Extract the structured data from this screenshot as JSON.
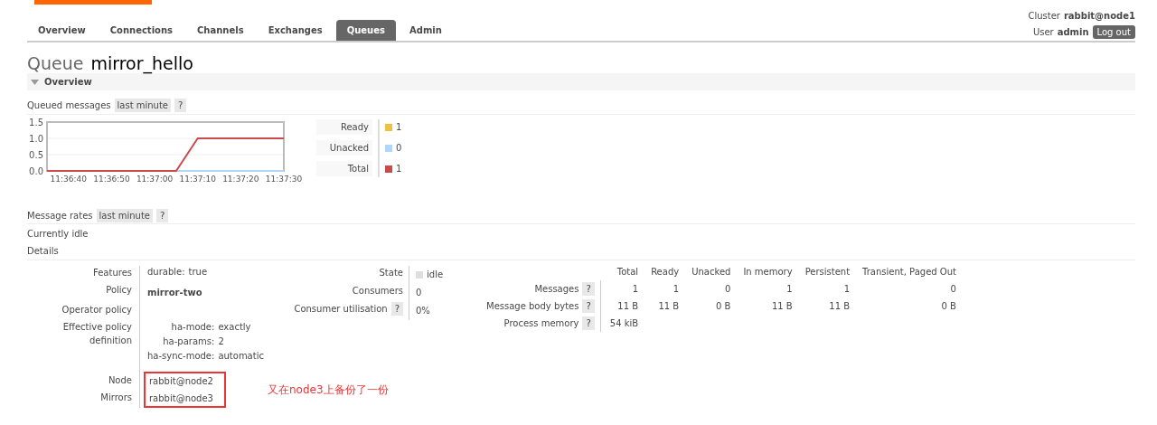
{
  "nav": {
    "tabs": [
      {
        "label": "Overview",
        "selected": false
      },
      {
        "label": "Connections",
        "selected": false
      },
      {
        "label": "Channels",
        "selected": false
      },
      {
        "label": "Exchanges",
        "selected": false
      },
      {
        "label": "Queues",
        "selected": true
      },
      {
        "label": "Admin",
        "selected": false
      }
    ]
  },
  "session": {
    "cluster_label": "Cluster",
    "cluster": "rabbit@node1",
    "user_label": "User",
    "user": "admin",
    "logout": "Log out"
  },
  "title": {
    "prefix": "Queue",
    "name": "mirror_hello"
  },
  "section": {
    "title": "Overview",
    "expanded": true
  },
  "queued": {
    "label": "Queued messages",
    "range": "last minute",
    "help": "?",
    "chart_data": {
      "type": "line",
      "categories": [
        null,
        "11:36:40",
        null,
        "11:36:50",
        null,
        "11:37:00",
        null,
        "11:37:10",
        null,
        "11:37:20",
        null,
        "11:37:30"
      ],
      "ylim": [
        0,
        1.5
      ],
      "yticks": [
        {
          "value": 0,
          "label": "0.0"
        },
        {
          "value": 0.5,
          "label": "0.5"
        },
        {
          "value": 1,
          "label": "1.0"
        },
        {
          "value": 1.5,
          "label": "1.5"
        }
      ],
      "series": [
        {
          "name": "Ready",
          "color": "#edc240",
          "values": [
            null,
            null,
            null,
            null,
            null,
            null,
            null,
            null,
            null,
            null,
            null,
            null
          ]
        },
        {
          "name": "Unacked",
          "color": "#afd8f8",
          "values": [
            null,
            null,
            null,
            null,
            null,
            null,
            0,
            0,
            0,
            0,
            0,
            0
          ]
        },
        {
          "name": "Total",
          "color": "#cb4b4b",
          "values": [
            0,
            0,
            0,
            0,
            0,
            0,
            0,
            1,
            1,
            1,
            1,
            1
          ]
        }
      ]
    },
    "legend_values": [
      "1",
      "0",
      "1"
    ]
  },
  "rates": {
    "label": "Message rates",
    "range": "last minute",
    "help": "?",
    "status": "Currently idle"
  },
  "details": {
    "title": "Details",
    "left": [
      {
        "label": "Features",
        "kind": "pair",
        "key": "durable:",
        "value": "true"
      },
      {
        "label": "Policy",
        "kind": "bold",
        "value": "mirror-two"
      },
      {
        "label": "Operator policy",
        "kind": "empty"
      },
      {
        "label": "Effective policy definition",
        "kind": "defs",
        "items": [
          {
            "key": "ha-mode:",
            "value": "exactly"
          },
          {
            "key": "ha-params:",
            "value": "2"
          },
          {
            "key": "ha-sync-mode:",
            "value": "automatic"
          }
        ]
      }
    ],
    "nodes": [
      {
        "label": "Node",
        "value": "rabbit@node2"
      },
      {
        "label": "Mirrors",
        "value": "rabbit@node3"
      }
    ],
    "annotation": "又在node3上备份了一份",
    "middle": [
      {
        "label": "State",
        "value": "idle",
        "kind": "state",
        "color": "#dddddd"
      },
      {
        "label": "Consumers",
        "value": "0",
        "kind": "plain"
      },
      {
        "label": "Consumer utilisation",
        "help": "?",
        "value": "0%",
        "kind": "plain"
      }
    ],
    "stats": {
      "columns": [
        "Total",
        "Ready",
        "Unacked",
        "In memory",
        "Persistent",
        "Transient, Paged Out"
      ],
      "rows": [
        {
          "label": "Messages",
          "help": "?",
          "cells": [
            "1",
            "1",
            "0",
            "1",
            "1",
            "0"
          ]
        },
        {
          "label": "Message body bytes",
          "help": "?",
          "cells": [
            "11 B",
            "11 B",
            "0 B",
            "11 B",
            "11 B",
            "0 B"
          ]
        },
        {
          "label": "Process memory",
          "help": "?",
          "cells": [
            "54 kiB"
          ]
        }
      ]
    }
  }
}
